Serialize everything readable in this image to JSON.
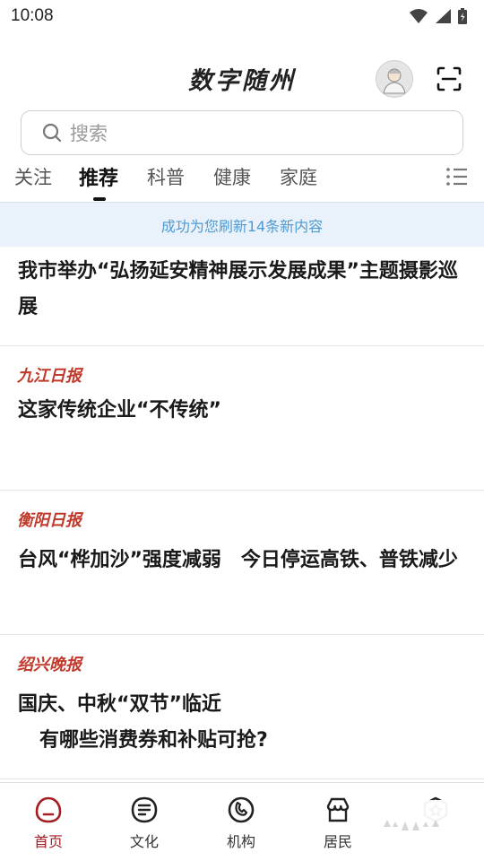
{
  "status_bar": {
    "time": "10:08"
  },
  "header": {
    "title": "数字随州"
  },
  "search": {
    "placeholder": "搜索"
  },
  "tabs": [
    {
      "label": "关注"
    },
    {
      "label": "推荐"
    },
    {
      "label": "科普"
    },
    {
      "label": "健康"
    },
    {
      "label": "家庭"
    }
  ],
  "banner": {
    "text": "成功为您刷新14条新内容"
  },
  "feed": [
    {
      "source": "",
      "title": "我市举办“弘扬延安精神展示发展成果”主题摄影巡展"
    },
    {
      "source": "九江日报",
      "title": "这家传统企业“不传统”"
    },
    {
      "source": "衡阳日报",
      "title": "台风“桦加沙”强度减弱　今日停运高铁、普铁减少"
    },
    {
      "source": "绍兴晚报",
      "title": "国庆、中秋“双节”临近",
      "title2": "有哪些消费券和补贴可抢?"
    }
  ],
  "bottom_nav": [
    {
      "label": "首页",
      "icon": "home-icon"
    },
    {
      "label": "文化",
      "icon": "culture-icon"
    },
    {
      "label": "机构",
      "icon": "institution-icon"
    },
    {
      "label": "居民",
      "icon": "resident-icon"
    },
    {
      "label": "",
      "icon": "star-badge-icon"
    }
  ],
  "colors": {
    "accent": "#a31d22",
    "source_red": "#c0392b",
    "banner_bg": "#e9f2fa",
    "banner_text": "#4f9ad3"
  }
}
